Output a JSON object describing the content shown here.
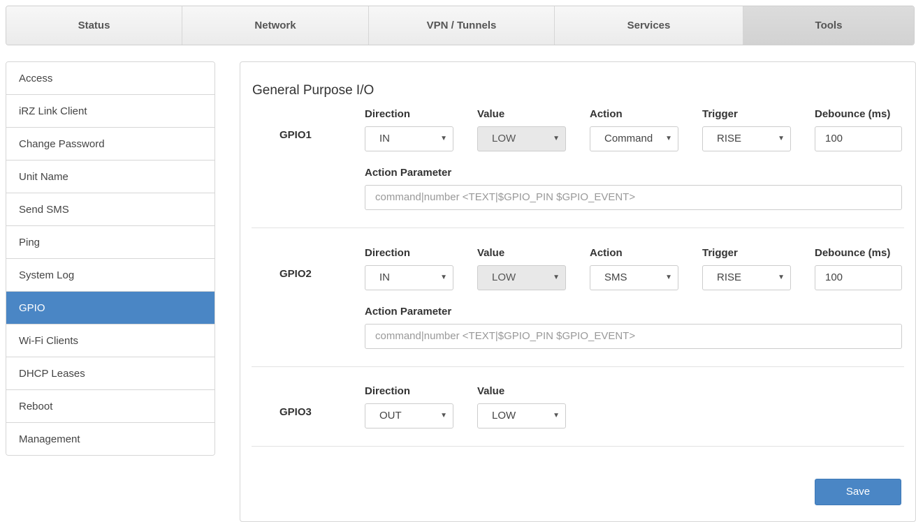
{
  "topnav": {
    "tabs": [
      {
        "label": "Status"
      },
      {
        "label": "Network"
      },
      {
        "label": "VPN / Tunnels"
      },
      {
        "label": "Services"
      },
      {
        "label": "Tools"
      }
    ],
    "active": "Tools"
  },
  "sidebar": {
    "items": [
      {
        "label": "Access"
      },
      {
        "label": "iRZ Link Client"
      },
      {
        "label": "Change Password"
      },
      {
        "label": "Unit Name"
      },
      {
        "label": "Send SMS"
      },
      {
        "label": "Ping"
      },
      {
        "label": "System Log"
      },
      {
        "label": "GPIO"
      },
      {
        "label": "Wi-Fi Clients"
      },
      {
        "label": "DHCP Leases"
      },
      {
        "label": "Reboot"
      },
      {
        "label": "Management"
      }
    ],
    "active": "GPIO"
  },
  "main": {
    "title": "General Purpose I/O",
    "labels": {
      "direction": "Direction",
      "value": "Value",
      "action": "Action",
      "trigger": "Trigger",
      "debounce": "Debounce (ms)",
      "action_parameter": "Action Parameter"
    },
    "gpio": [
      {
        "name": "GPIO1",
        "direction": "IN",
        "value": "LOW",
        "action": "Command",
        "trigger": "RISE",
        "debounce": "100",
        "action_parameter_placeholder": "command|number <TEXT|$GPIO_PIN $GPIO_EVENT>"
      },
      {
        "name": "GPIO2",
        "direction": "IN",
        "value": "LOW",
        "action": "SMS",
        "trigger": "RISE",
        "debounce": "100",
        "action_parameter_placeholder": "command|number <TEXT|$GPIO_PIN $GPIO_EVENT>"
      },
      {
        "name": "GPIO3",
        "direction": "OUT",
        "value": "LOW"
      }
    ],
    "save_label": "Save"
  },
  "icons": {
    "dropdown": "▼"
  },
  "colors": {
    "accent": "#4a86c5"
  }
}
